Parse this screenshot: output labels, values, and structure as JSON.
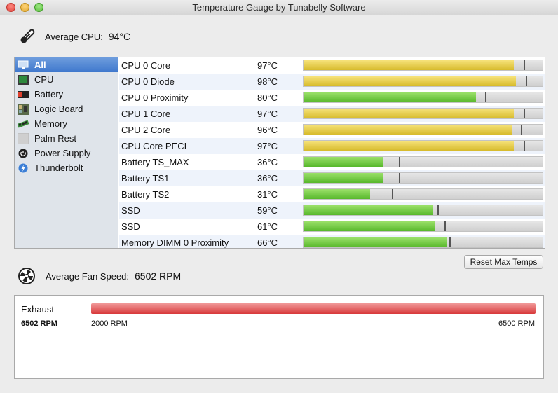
{
  "window": {
    "title": "Temperature Gauge by Tunabelly Software"
  },
  "cpu_summary": {
    "label": "Average CPU:",
    "value": "94°C"
  },
  "sidebar": {
    "items": [
      {
        "label": "All",
        "icon": "display-icon",
        "selected": true
      },
      {
        "label": "CPU",
        "icon": "cpu-icon",
        "selected": false
      },
      {
        "label": "Battery",
        "icon": "battery-icon",
        "selected": false
      },
      {
        "label": "Logic Board",
        "icon": "logic-board-icon",
        "selected": false
      },
      {
        "label": "Memory",
        "icon": "memory-icon",
        "selected": false
      },
      {
        "label": "Palm Rest",
        "icon": "palm-rest-icon",
        "selected": false
      },
      {
        "label": "Power Supply",
        "icon": "power-icon",
        "selected": false
      },
      {
        "label": "Thunderbolt",
        "icon": "thunderbolt-icon",
        "selected": false
      }
    ]
  },
  "sensors": [
    {
      "name": "CPU 0 Core",
      "temp": "97°C",
      "level": 0.88,
      "max": 0.92,
      "color": "yellow"
    },
    {
      "name": "CPU 0 Diode",
      "temp": "98°C",
      "level": 0.89,
      "max": 0.93,
      "color": "yellow"
    },
    {
      "name": "CPU 0 Proximity",
      "temp": "80°C",
      "level": 0.72,
      "max": 0.76,
      "color": "green"
    },
    {
      "name": "CPU 1 Core",
      "temp": "97°C",
      "level": 0.88,
      "max": 0.92,
      "color": "yellow"
    },
    {
      "name": "CPU 2 Core",
      "temp": "96°C",
      "level": 0.87,
      "max": 0.91,
      "color": "yellow"
    },
    {
      "name": "CPU Core PECI",
      "temp": "97°C",
      "level": 0.88,
      "max": 0.92,
      "color": "yellow"
    },
    {
      "name": "Battery TS_MAX",
      "temp": "36°C",
      "level": 0.33,
      "max": 0.4,
      "color": "green"
    },
    {
      "name": "Battery TS1",
      "temp": "36°C",
      "level": 0.33,
      "max": 0.4,
      "color": "green"
    },
    {
      "name": "Battery TS2",
      "temp": "31°C",
      "level": 0.28,
      "max": 0.37,
      "color": "green"
    },
    {
      "name": "SSD",
      "temp": "59°C",
      "level": 0.54,
      "max": 0.56,
      "color": "green"
    },
    {
      "name": "SSD",
      "temp": "61°C",
      "level": 0.55,
      "max": 0.59,
      "color": "green"
    },
    {
      "name": "Memory DIMM 0 Proximity",
      "temp": "66°C",
      "level": 0.6,
      "max": 0.61,
      "color": "green"
    }
  ],
  "reset_button": {
    "label": "Reset Max Temps"
  },
  "fan_summary": {
    "label": "Average Fan Speed:",
    "value": "6502 RPM"
  },
  "fans": [
    {
      "name": "Exhaust",
      "current": "6502 RPM",
      "min": "2000 RPM",
      "max": "6500 RPM",
      "level": 1.0
    }
  ]
}
